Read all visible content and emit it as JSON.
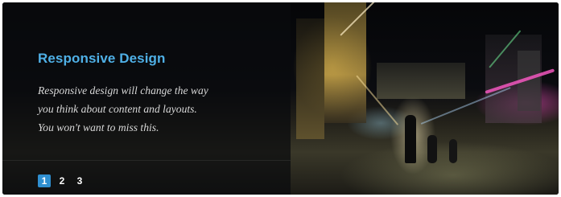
{
  "slide": {
    "title": "Responsive Design",
    "description_lines": [
      "Responsive design will change the way",
      "you think about content and layouts.",
      "You won't want to miss this."
    ]
  },
  "pager": {
    "pages": [
      "1",
      "2",
      "3"
    ],
    "active_index": 0
  },
  "colors": {
    "title": "#4fb0e6",
    "active_page": "#2f8fd0",
    "overlay": "#0a0b0e"
  }
}
